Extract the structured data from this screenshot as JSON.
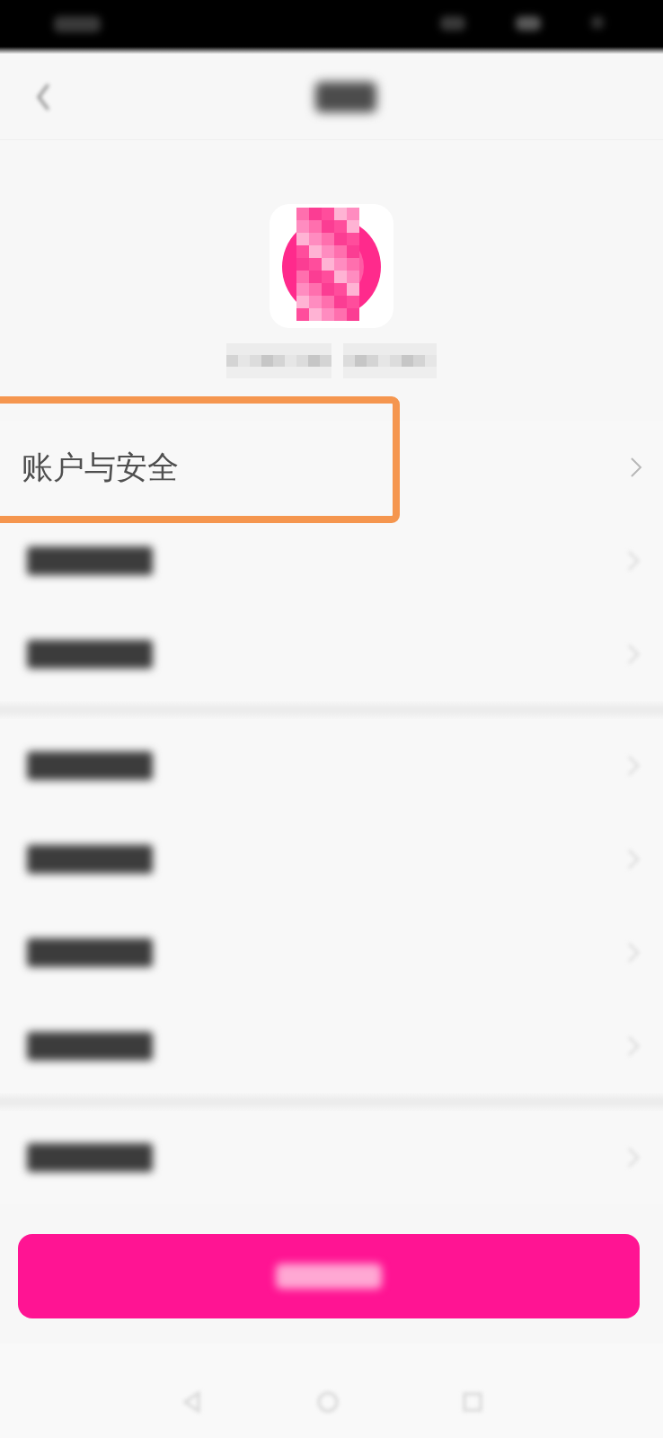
{
  "settings_groups": [
    {
      "rows": [
        {
          "kind": "text",
          "label": "账户与安全",
          "highlighted": true
        },
        {
          "kind": "blurred",
          "highlighted": false
        },
        {
          "kind": "blurred",
          "highlighted": false
        }
      ]
    },
    {
      "rows": [
        {
          "kind": "blurred",
          "highlighted": false
        },
        {
          "kind": "blurred",
          "highlighted": false
        },
        {
          "kind": "blurred",
          "highlighted": false
        },
        {
          "kind": "blurred",
          "highlighted": false
        }
      ]
    },
    {
      "rows": [
        {
          "kind": "blurred",
          "highlighted": false
        }
      ]
    }
  ]
}
